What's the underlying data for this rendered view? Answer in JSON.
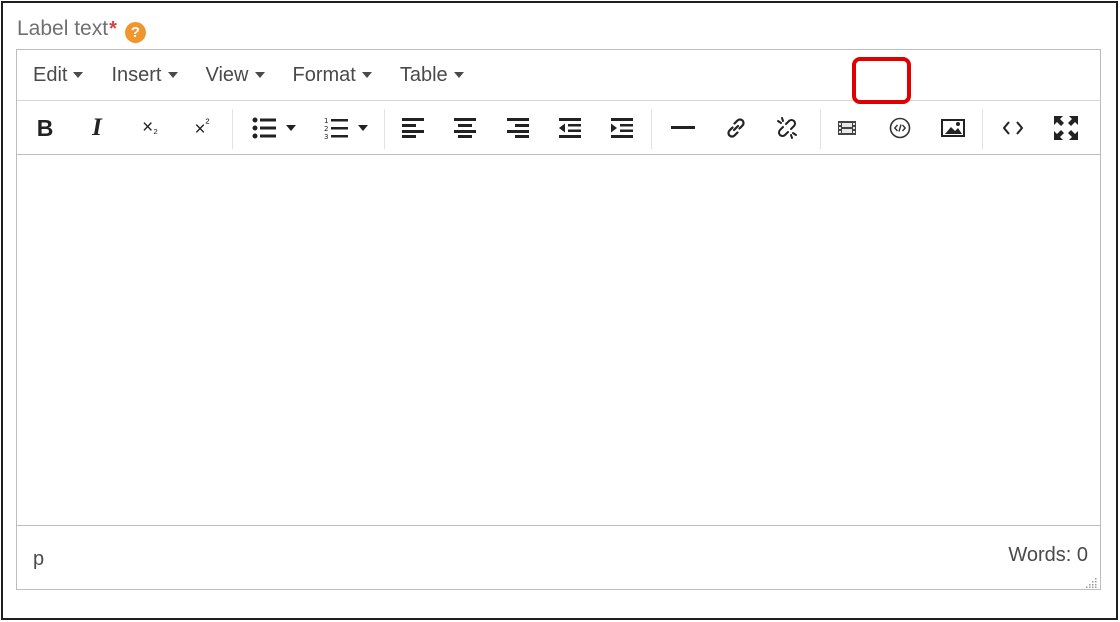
{
  "field": {
    "label": "Label text",
    "required_mark": "*",
    "help_glyph": "?"
  },
  "menubar": {
    "items": [
      {
        "label": "Edit"
      },
      {
        "label": "Insert"
      },
      {
        "label": "View"
      },
      {
        "label": "Format"
      },
      {
        "label": "Table"
      }
    ]
  },
  "toolbar": {
    "bold": "B",
    "italic": "I",
    "subscript": "×",
    "subscript_mark": "₂",
    "superscript": "×",
    "superscript_mark": "²",
    "highlighted_button": "media-embed-button",
    "highlight_color": "#e00000"
  },
  "status": {
    "path": "p",
    "word_count": "Words: 0"
  },
  "icons": [
    "help-icon",
    "bold-icon",
    "italic-icon",
    "subscript-icon",
    "superscript-icon",
    "bullet-list-icon",
    "numbered-list-icon",
    "align-left-icon",
    "align-center-icon",
    "align-right-icon",
    "outdent-icon",
    "indent-icon",
    "horizontal-rule-icon",
    "link-icon",
    "unlink-icon",
    "film-icon",
    "embed-code-icon",
    "image-icon",
    "source-code-icon",
    "fullscreen-icon",
    "resize-handle-icon"
  ]
}
